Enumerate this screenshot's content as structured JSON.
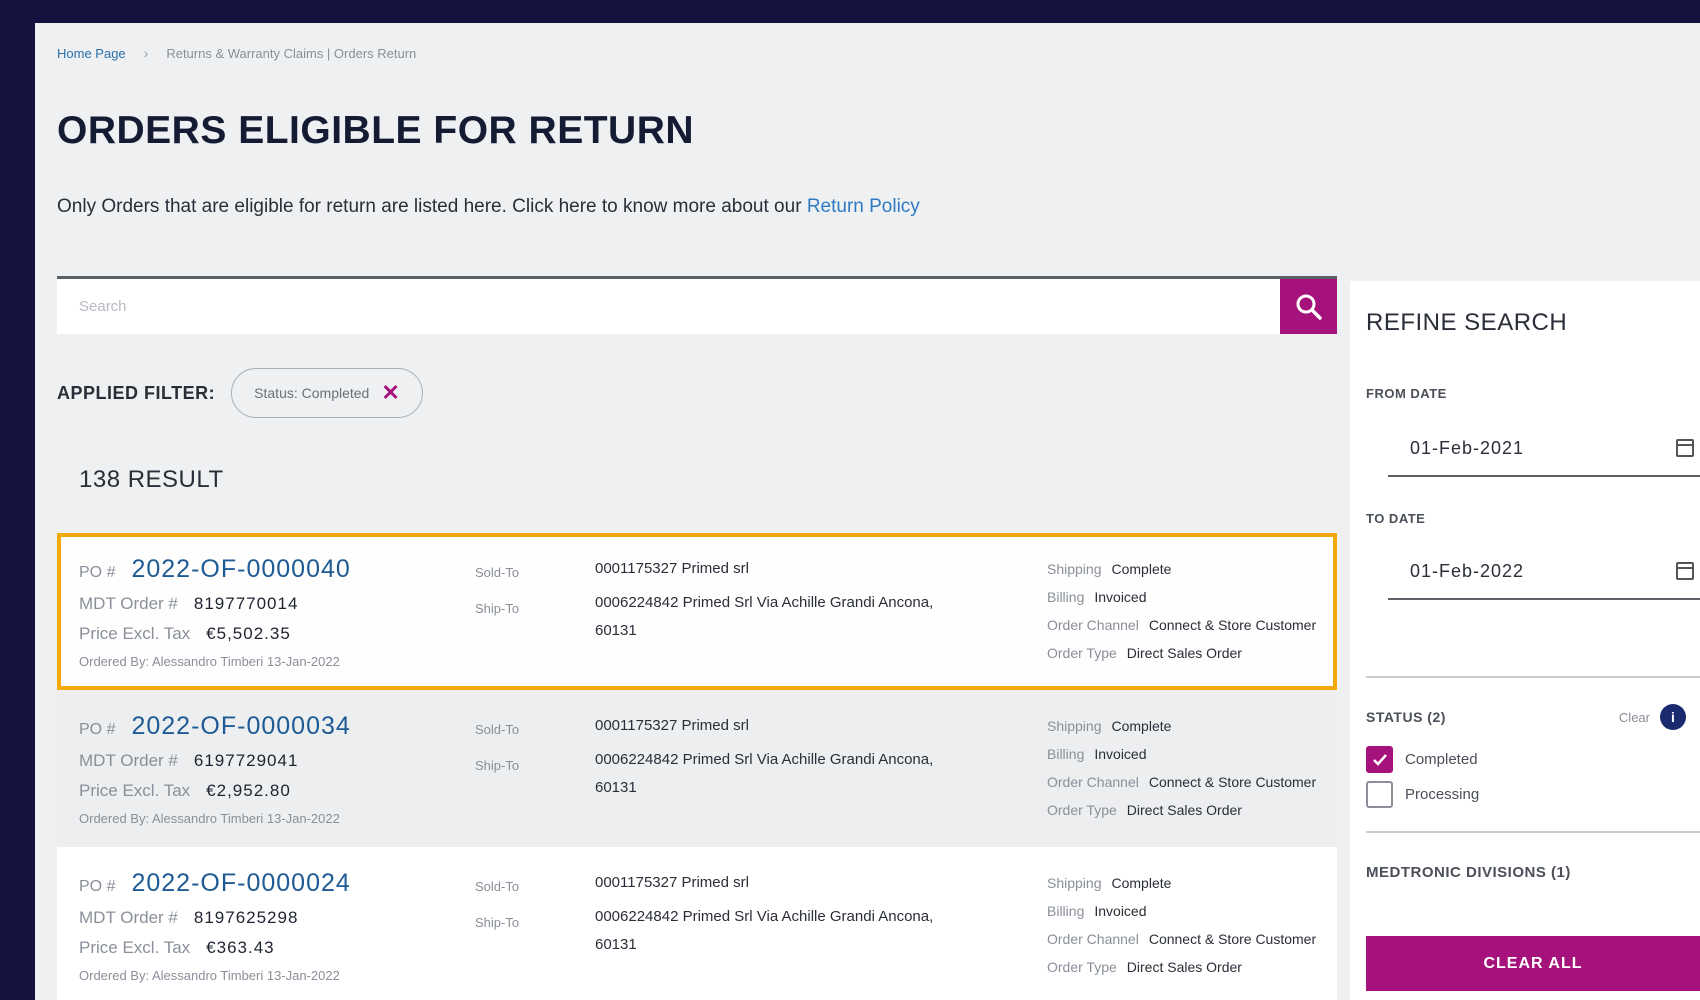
{
  "breadcrumb": {
    "home": "Home Page",
    "current": "Returns & Warranty Claims | Orders Return"
  },
  "page_title": "ORDERS ELIGIBLE FOR RETURN",
  "intro": {
    "text": "Only Orders that are eligible for return are listed here. Click here to know more about our",
    "link": "Return Policy"
  },
  "search": {
    "placeholder": "Search"
  },
  "applied_filter": {
    "label": "APPLIED FILTER:",
    "chip": "Status: Completed"
  },
  "result_count": "138 RESULT",
  "orders": [
    {
      "po_label": "PO #",
      "po_number": "2022-OF-0000040",
      "mdt_label": "MDT Order #",
      "mdt_value": "8197770014",
      "price_label": "Price Excl. Tax",
      "price_value": "€5,502.35",
      "ordered_by": "Ordered By: Alessandro Timberi 13-Jan-2022",
      "sold_to_label": "Sold-To",
      "ship_to_label": "Ship-To",
      "sold_to": "0001175327 Primed srl",
      "ship_to": "0006224842 Primed Srl Via Achille Grandi Ancona, 60131",
      "shipping_label": "Shipping",
      "shipping": "Complete",
      "billing_label": "Billing",
      "billing": "Invoiced",
      "channel_label": "Order Channel",
      "channel": "Connect & Store Customer",
      "type_label": "Order Type",
      "type": "Direct Sales Order"
    },
    {
      "po_label": "PO #",
      "po_number": "2022-OF-0000034",
      "mdt_label": "MDT Order #",
      "mdt_value": "6197729041",
      "price_label": "Price Excl. Tax",
      "price_value": "€2,952.80",
      "ordered_by": "Ordered By: Alessandro Timberi 13-Jan-2022",
      "sold_to_label": "Sold-To",
      "ship_to_label": "Ship-To",
      "sold_to": "0001175327 Primed srl",
      "ship_to": "0006224842 Primed Srl Via Achille Grandi Ancona, 60131",
      "shipping_label": "Shipping",
      "shipping": "Complete",
      "billing_label": "Billing",
      "billing": "Invoiced",
      "channel_label": "Order Channel",
      "channel": "Connect & Store Customer",
      "type_label": "Order Type",
      "type": "Direct Sales Order"
    },
    {
      "po_label": "PO #",
      "po_number": "2022-OF-0000024",
      "mdt_label": "MDT Order #",
      "mdt_value": "8197625298",
      "price_label": "Price Excl. Tax",
      "price_value": "€363.43",
      "ordered_by": "Ordered By: Alessandro Timberi 13-Jan-2022",
      "sold_to_label": "Sold-To",
      "ship_to_label": "Ship-To",
      "sold_to": "0001175327 Primed srl",
      "ship_to": "0006224842 Primed Srl Via Achille Grandi Ancona, 60131",
      "shipping_label": "Shipping",
      "shipping": "Complete",
      "billing_label": "Billing",
      "billing": "Invoiced",
      "channel_label": "Order Channel",
      "channel": "Connect & Store Customer",
      "type_label": "Order Type",
      "type": "Direct Sales Order"
    }
  ],
  "refine": {
    "title": "REFINE SEARCH",
    "from_label": "FROM DATE",
    "from_value": "01-Feb-2021",
    "to_label": "TO DATE",
    "to_value": "01-Feb-2022",
    "status_label": "STATUS (2)",
    "clear_label": "Clear",
    "options": [
      {
        "label": "Completed",
        "checked": true
      },
      {
        "label": "Processing",
        "checked": false
      }
    ],
    "divisions_label": "MEDTRONIC DIVISIONS (1)",
    "clear_all": "CLEAR ALL"
  },
  "colors": {
    "brand": "#a5127b",
    "frame": "#14133f",
    "highlight": "#f3a90a",
    "link": "#1e5a94"
  }
}
